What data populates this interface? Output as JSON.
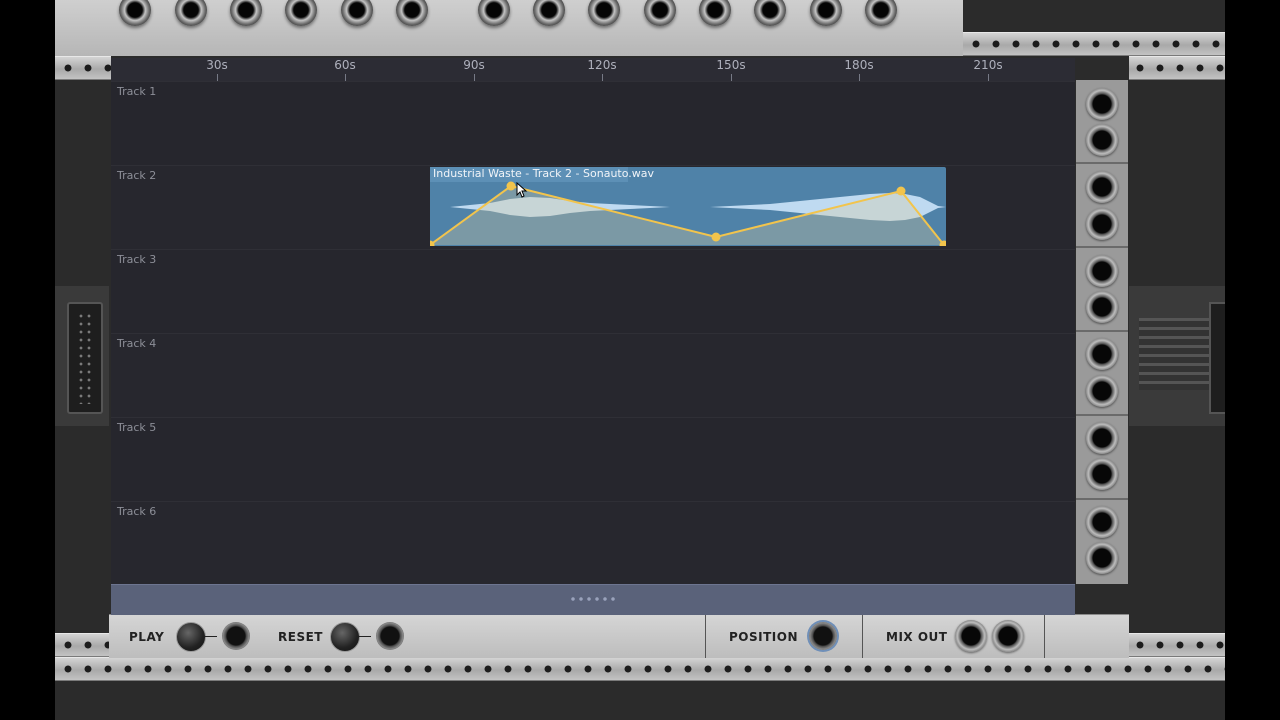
{
  "timeline": {
    "ruler_ticks": [
      "30s",
      "60s",
      "90s",
      "120s",
      "150s",
      "180s",
      "210s"
    ],
    "tracks": [
      "Track 1",
      "Track 2",
      "Track 3",
      "Track 4",
      "Track 5",
      "Track 6"
    ],
    "clip": {
      "label": "Industrial Waste - Track 2 - Sonauto.wav",
      "track": "Track 2",
      "color": "#4f82a8",
      "automation_color": "#f2c44c"
    }
  },
  "controls": {
    "play_label": "PLAY",
    "reset_label": "RESET",
    "position_label": "POSITION",
    "mix_out_label": "MIX OUT"
  }
}
